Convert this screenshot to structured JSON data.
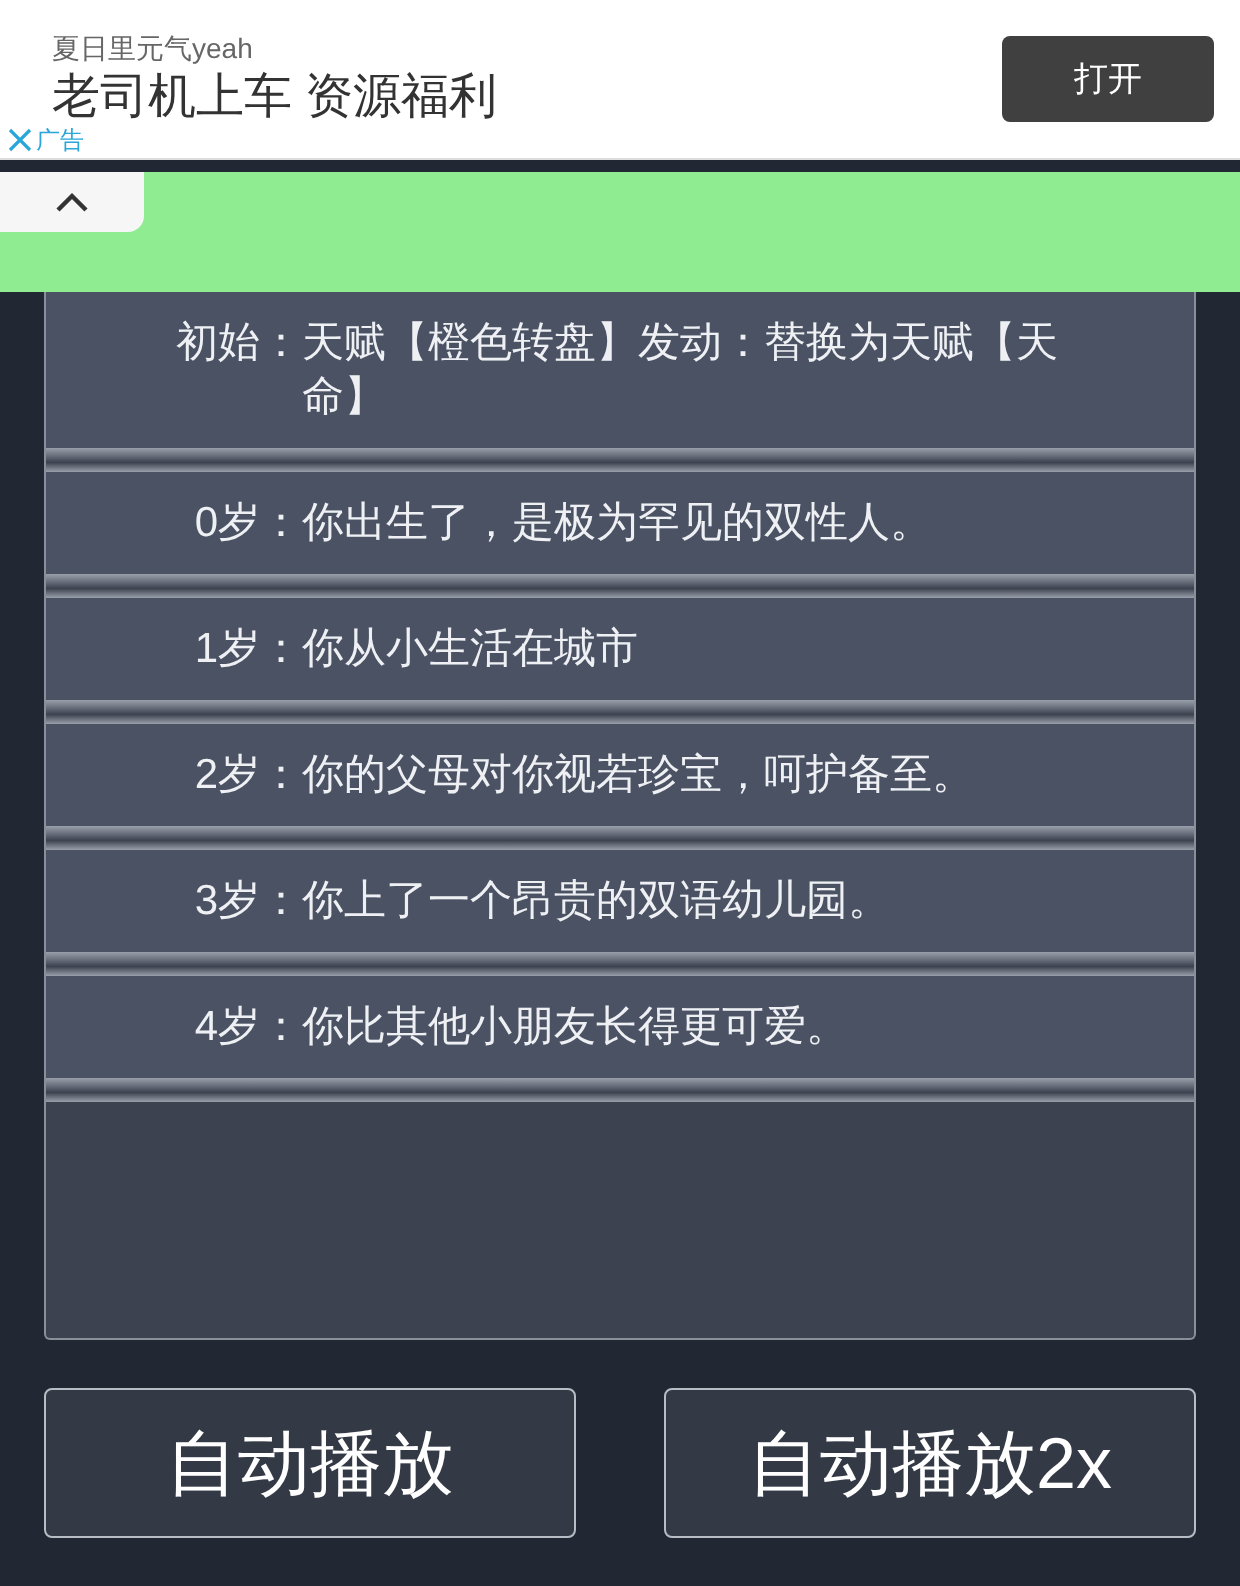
{
  "ad": {
    "source": "夏日里元气yeah",
    "headline": "老司机上车 资源福利",
    "open_button": "打开",
    "close_label": "广告"
  },
  "log": [
    {
      "age": "初始：",
      "text": "天赋【橙色转盘】发动：替换为天赋【天命】"
    },
    {
      "age": "0岁：",
      "text": "你出生了，是极为罕见的双性人。"
    },
    {
      "age": "1岁：",
      "text": "你从小生活在城市"
    },
    {
      "age": "2岁：",
      "text": "你的父母对你视若珍宝，呵护备至。"
    },
    {
      "age": "3岁：",
      "text": "你上了一个昂贵的双语幼儿园。"
    },
    {
      "age": "4岁：",
      "text": "你比其他小朋友长得更可爱。"
    }
  ],
  "buttons": [
    "自动播放",
    "自动播放2x"
  ]
}
